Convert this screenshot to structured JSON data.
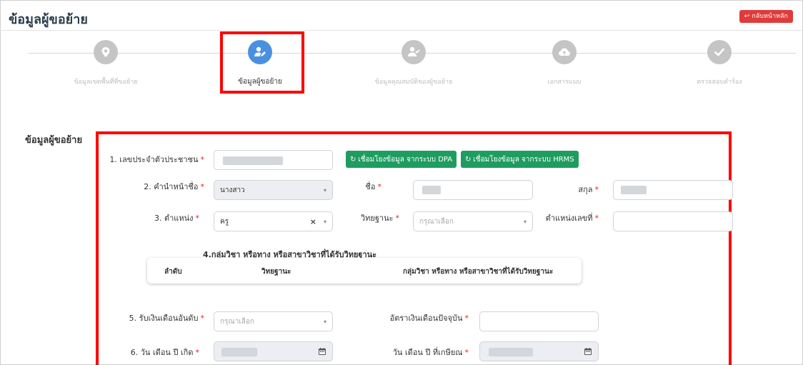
{
  "header": {
    "title": "ข้อมูลผู้ขอย้าย",
    "back_label": "กลับหน้าหลัก"
  },
  "steps": [
    {
      "label": "ข้อมูลเขตพื้นที่ที่ขอย้าย",
      "icon": "map-pin-icon",
      "active": false
    },
    {
      "label": "ข้อมูลผู้ขอย้าย",
      "icon": "user-edit-icon",
      "active": true
    },
    {
      "label": "ข้อมูลคุณสมบัติของผู้ขอย้าย",
      "icon": "user-check-icon",
      "active": false
    },
    {
      "label": "เอกสารแนบ",
      "icon": "cloud-upload-icon",
      "active": false
    },
    {
      "label": "ตรวจสอบคำร้อง",
      "icon": "check-icon",
      "active": false
    }
  ],
  "section": {
    "title": "ข้อมูลผู้ขอย้าย"
  },
  "form": {
    "id_label": "1. เลขประจำตัวประชาชน",
    "dpa_button": "เชื่อมโยงข้อมูล จากระบบ DPA",
    "hrms_button": "เชื่อมโยงข้อมูล จากระบบ HRMS",
    "prefix_label": "2. คำนำหน้าชื่อ",
    "prefix_value": "นางสาว",
    "firstname_label": "ชื่อ",
    "lastname_label": "สกุล",
    "position_label": "3. ตำแหน่ง",
    "position_value": "ครู",
    "academic_label": "วิทยฐานะ",
    "academic_placeholder": "กรุณาเลือก",
    "position_no_label": "ตำแหน่งเลขที่",
    "subject_group_label": "4.กลุ่มวิชา หรือทาง หรือสาขาวิชาที่ได้รับวิทยฐานะ",
    "table_headers": [
      "ลำดับ",
      "วิทยฐานะ",
      "กลุ่มวิชา หรือทาง หรือสาขาวิชาที่ได้รับวิทยฐานะ"
    ],
    "salary_level_label": "5. รับเงินเดือนอันดับ",
    "salary_level_placeholder": "กรุณาเลือก",
    "salary_rate_label": "อัตราเงินเดือนปัจจุบัน",
    "birthdate_label": "6. วัน เดือน ปี เกิด",
    "retire_label": "วัน เดือน ปี ที่เกษียณ"
  },
  "colors": {
    "accent": "#4a90e2",
    "green": "#1f9d60",
    "red": "#e03b3b",
    "highlight": "#ff0000"
  }
}
